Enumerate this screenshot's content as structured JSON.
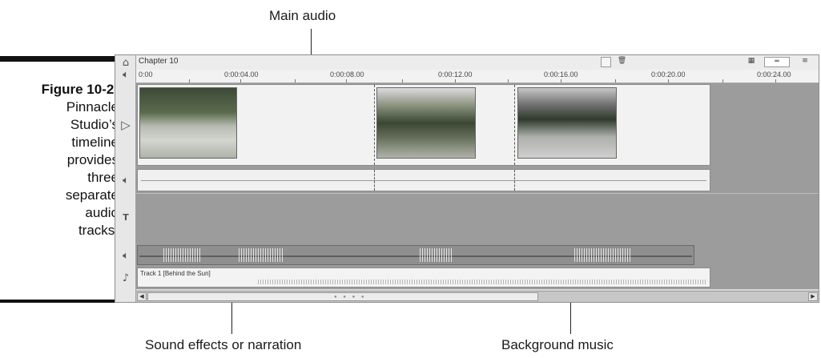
{
  "callouts": {
    "main_audio": "Main audio",
    "sound_effects": "Sound effects or narration",
    "background_music": "Background music"
  },
  "caption": {
    "figure": "Figure 10-2:",
    "lines": [
      "Pinnacle",
      "Studio’s",
      "timeline",
      "provides",
      "three",
      "separate",
      "audio",
      "tracks."
    ]
  },
  "timeline": {
    "chapter_title": "Chapter 10",
    "ruler_start": "0:00",
    "ruler_labels": [
      "0:00:04.00",
      "0:00:08.00",
      "0:00:12.00",
      "0:00:16.00",
      "0:00:20.00",
      "0:00:24.00"
    ],
    "music_track_label": "Track 1 [Behind the Sun]",
    "icons": {
      "video": "camera-icon",
      "main_audio": "speaker-icon",
      "title": "title-icon",
      "sfx": "speaker-icon",
      "music": "music-note-icon"
    }
  },
  "colors": {
    "track_bg": "#9c9c9c",
    "clip_bg": "#f2f2f2"
  }
}
